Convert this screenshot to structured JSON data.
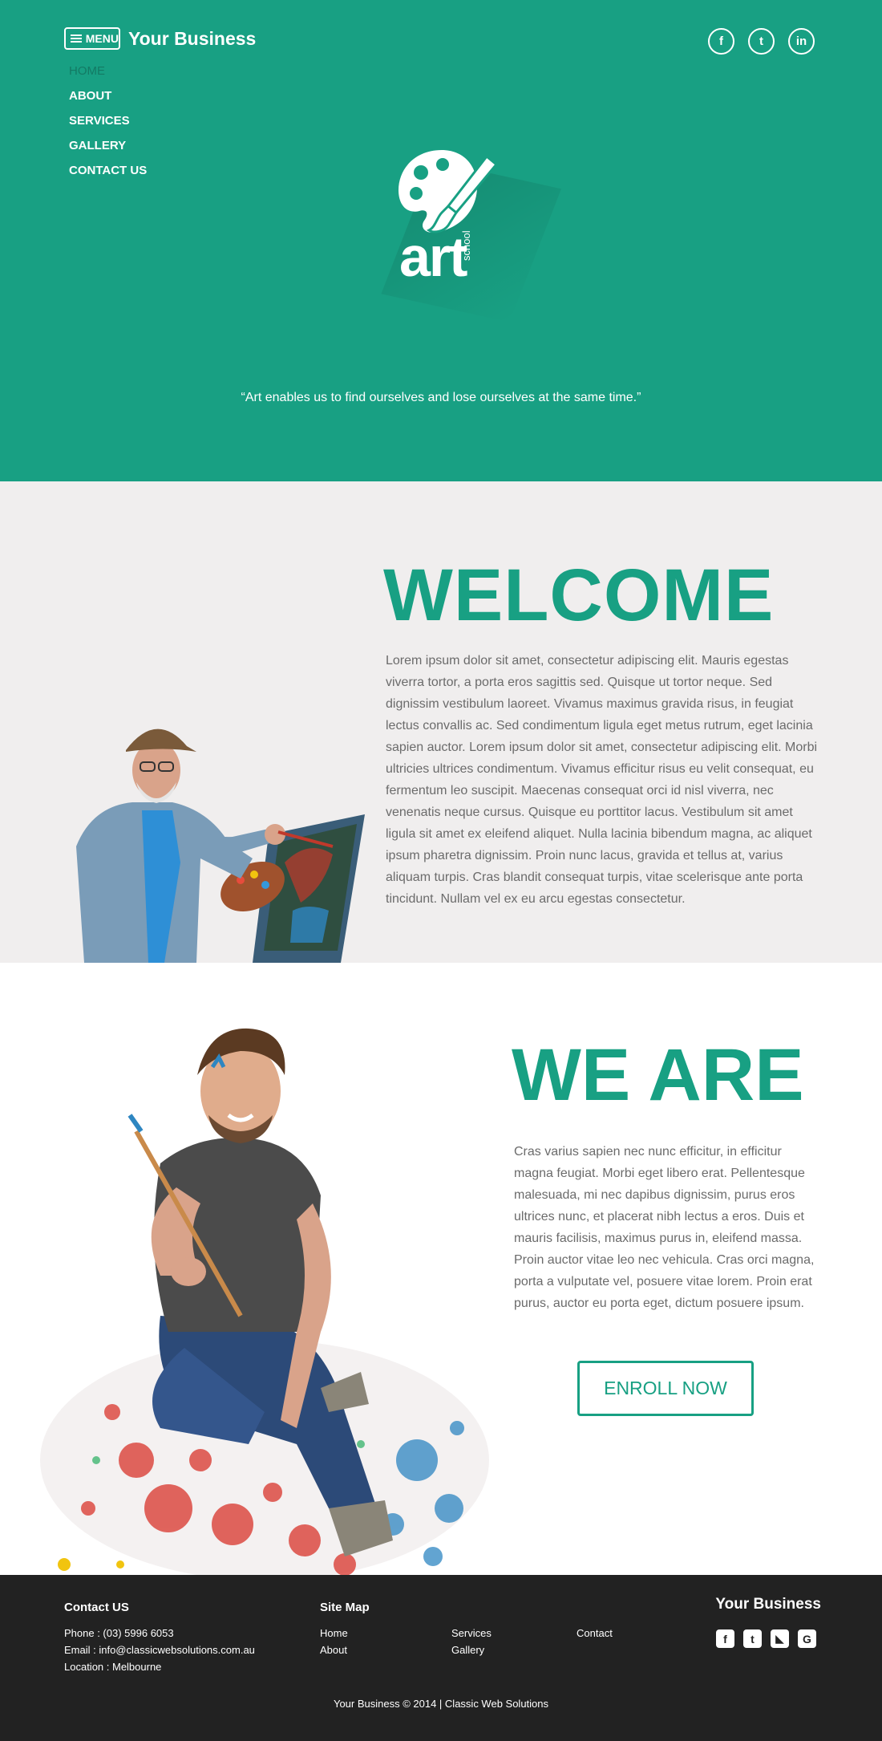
{
  "header": {
    "menu_label": "MENU",
    "brand": "Your Business",
    "nav": [
      {
        "label": "HOME",
        "active": true
      },
      {
        "label": "ABOUT"
      },
      {
        "label": "SERVICES"
      },
      {
        "label": "GALLERY"
      },
      {
        "label": "CONTACT US"
      }
    ],
    "socials": [
      {
        "icon": "facebook-icon",
        "glyph": "f"
      },
      {
        "icon": "twitter-icon",
        "glyph": "t"
      },
      {
        "icon": "linkedin-icon",
        "glyph": "in"
      }
    ]
  },
  "hero": {
    "logo_word": "art",
    "logo_sub": "school",
    "quote": "“Art enables us to find ourselves and lose ourselves at the same time.”"
  },
  "welcome": {
    "title": "WELCOME",
    "body": "Lorem ipsum dolor sit amet, consectetur adipiscing elit. Mauris egestas viverra tortor, a porta eros sagittis sed. Quisque ut tortor neque. Sed dignissim vestibulum laoreet. Vivamus maximus gravida risus, in feugiat lectus convallis ac. Sed condimentum ligula eget metus rutrum, eget lacinia sapien auctor. Lorem ipsum dolor sit amet, consectetur adipiscing elit. Morbi ultricies ultrices condimentum. Vivamus efficitur risus eu velit consequat, eu fermentum leo suscipit. Maecenas consequat orci id nisl viverra, nec venenatis neque cursus. Quisque eu porttitor lacus. Vestibulum sit amet ligula sit amet ex eleifend aliquet. Nulla lacinia bibendum magna, ac aliquet ipsum pharetra dignissim. Proin nunc lacus, gravida et tellus at, varius aliquam turpis. Cras blandit consequat turpis, vitae scelerisque ante porta tincidunt. Nullam vel ex eu arcu egestas consectetur."
  },
  "weare": {
    "title": "WE ARE",
    "body": "Cras varius sapien nec nunc efficitur, in efficitur magna feugiat. Morbi eget libero erat. Pellentesque malesuada, mi nec dapibus dignissim, purus eros ultrices nunc, et placerat nibh lectus a eros. Duis et mauris facilisis, maximus purus in, eleifend massa. Proin auctor vitae leo nec vehicula. Cras orci magna, porta a vulputate vel, posuere vitae lorem. Proin erat purus, auctor eu porta eget, dictum posuere ipsum.",
    "cta": "ENROLL NOW"
  },
  "footer": {
    "contact_title": "Contact US",
    "phone": "Phone : (03) 5996 6053",
    "email": "Email : info@classicwebsolutions.com.au",
    "location": "Location : Melbourne",
    "sitemap_title": "Site Map",
    "links": {
      "home": "Home",
      "about": "About",
      "services": "Services",
      "gallery": "Gallery",
      "contact": "Contact"
    },
    "brand": "Your Business",
    "icons": [
      {
        "icon": "facebook-icon",
        "glyph": "f"
      },
      {
        "icon": "twitter-icon",
        "glyph": "t"
      },
      {
        "icon": "rss-icon",
        "glyph": "◣"
      },
      {
        "icon": "google-icon",
        "glyph": "G"
      }
    ],
    "copyright": "Your Business © 2014  |  Classic Web Solutions"
  },
  "colors": {
    "accent": "#18a083",
    "light_bg": "#f0eeee",
    "footer_bg": "#222222",
    "body_text": "#6b6b6b"
  }
}
